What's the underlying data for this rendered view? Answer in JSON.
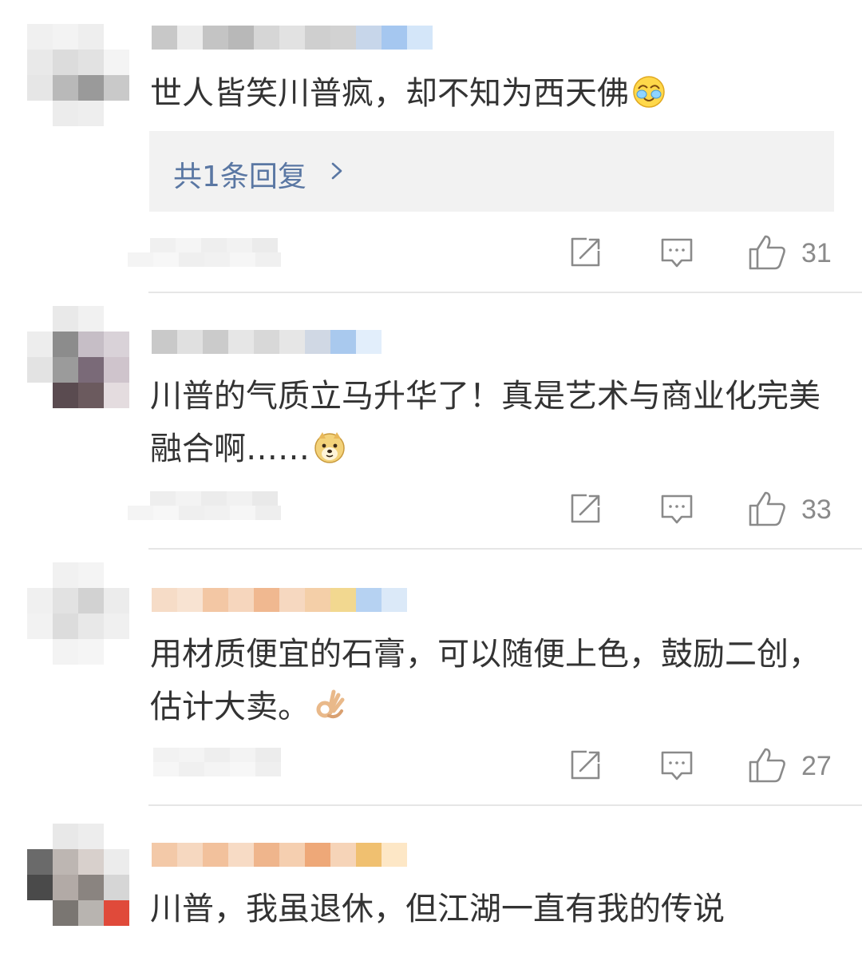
{
  "comments": [
    {
      "text": "世人皆笑川普疯，却不知为西天佛",
      "emoji": "laughing-tears-emoji",
      "reply_label": "共1条回复",
      "likes": "31"
    },
    {
      "text": "川普的气质立马升华了！真是艺术与商业化完美融合啊……",
      "emoji": "doge-emoji",
      "likes": "33"
    },
    {
      "text": "用材质便宜的石膏，可以随便上色，鼓励二创，估计大卖。",
      "emoji": "ok-hand-emoji",
      "likes": "27"
    },
    {
      "text": "川普，我虽退休，但江湖一直有我的传说"
    }
  ],
  "icons": {
    "share": "share-icon",
    "comment": "comment-icon",
    "like": "thumbs-up-icon"
  },
  "colors": {
    "reply_link": "#5a77a3",
    "icon_gray": "#8a8a8a",
    "reply_bg": "#f2f2f2"
  }
}
